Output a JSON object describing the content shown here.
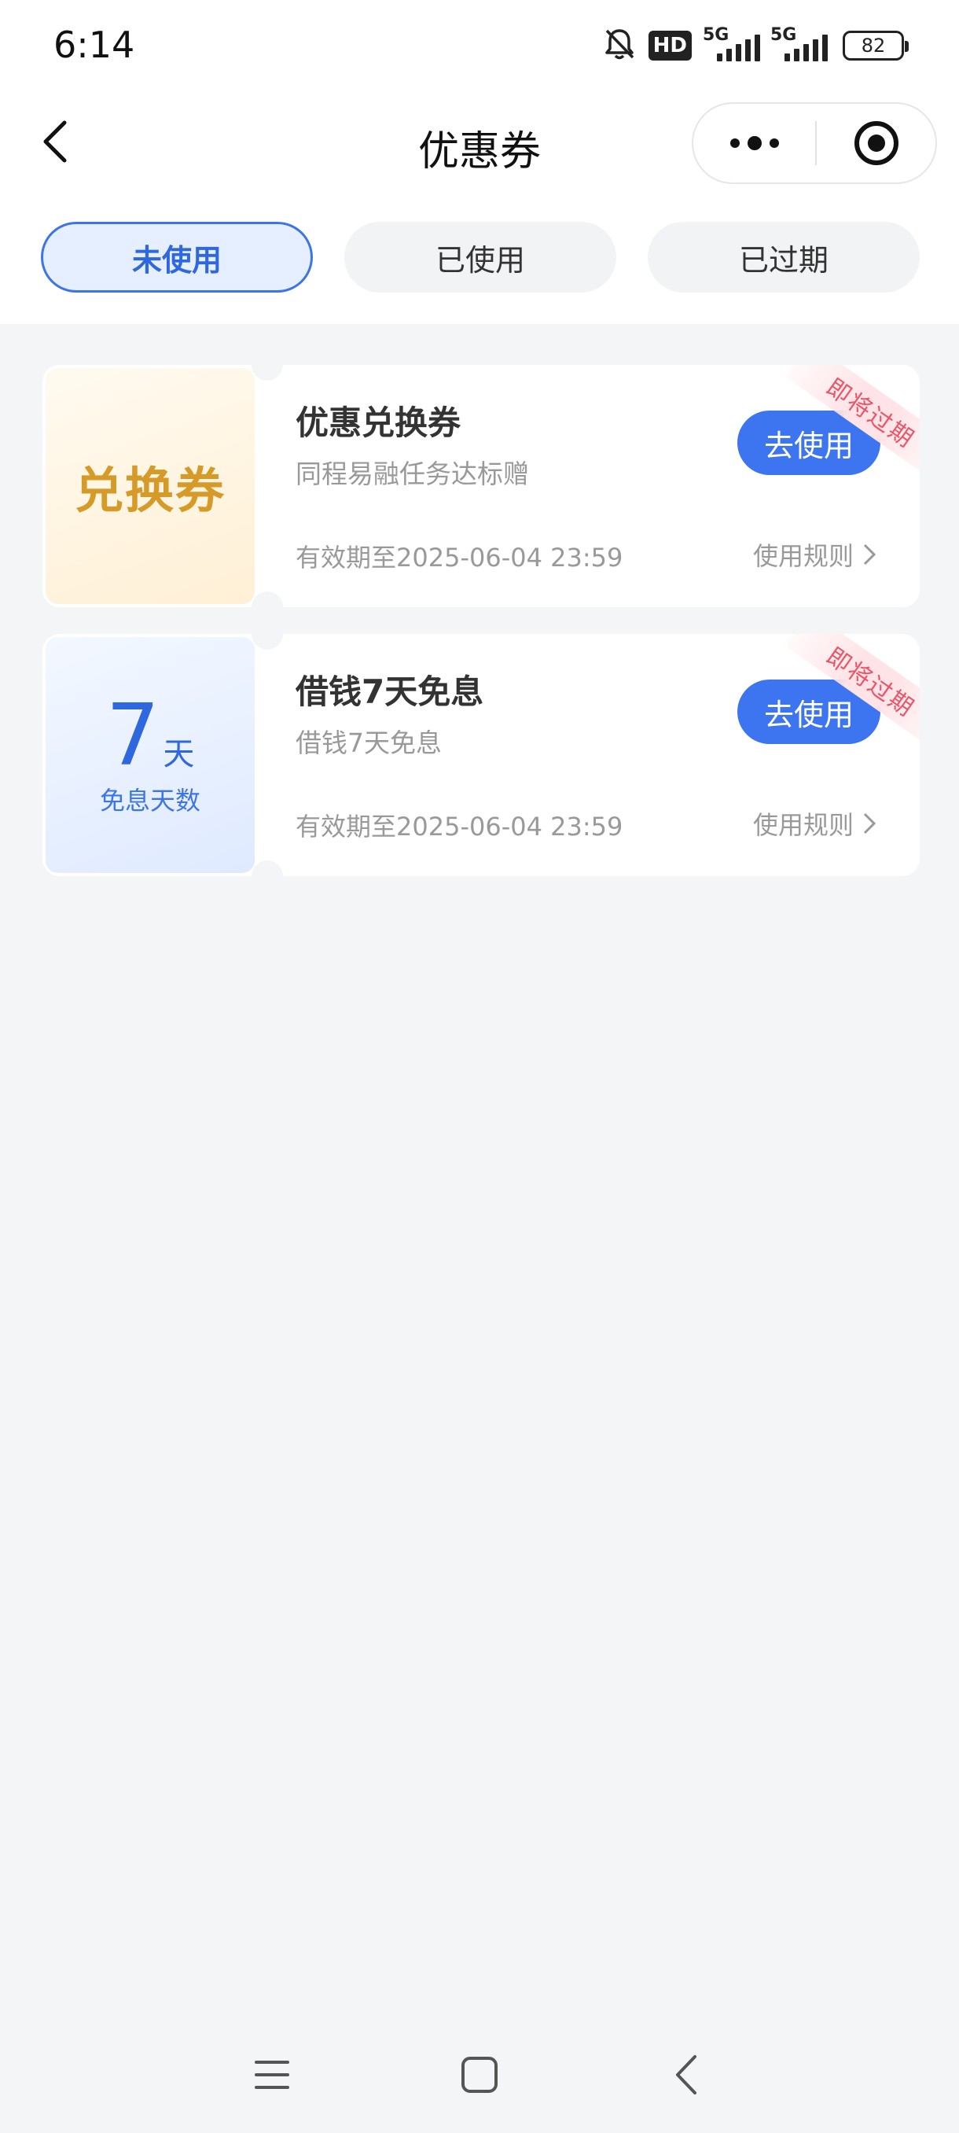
{
  "status_bar": {
    "time": "6:14",
    "hd_label": "HD",
    "net1": "5G",
    "net2": "5G",
    "battery": "82"
  },
  "nav": {
    "title": "优惠券"
  },
  "tabs": [
    {
      "label": "未使用",
      "active": true
    },
    {
      "label": "已使用",
      "active": false
    },
    {
      "label": "已过期",
      "active": false
    }
  ],
  "coupons": [
    {
      "stub_title": "兑换券",
      "title": "优惠兑换券",
      "subtitle": "同程易融任务达标赠",
      "validity": "有效期至2025-06-04 23:59",
      "rule_label": "使用规则",
      "use_label": "去使用",
      "ribbon": "即将过期"
    },
    {
      "stub_days": "7",
      "stub_unit": "天",
      "stub_sub": "免息天数",
      "title": "借钱7天免息",
      "subtitle": "借钱7天免息",
      "validity": "有效期至2025-06-04 23:59",
      "rule_label": "使用规则",
      "use_label": "去使用",
      "ribbon": "即将过期"
    }
  ],
  "colors": {
    "accent": "#3d75f0",
    "gold": "#d59a28",
    "warning": "#e9566a",
    "background": "#f4f5f7"
  }
}
